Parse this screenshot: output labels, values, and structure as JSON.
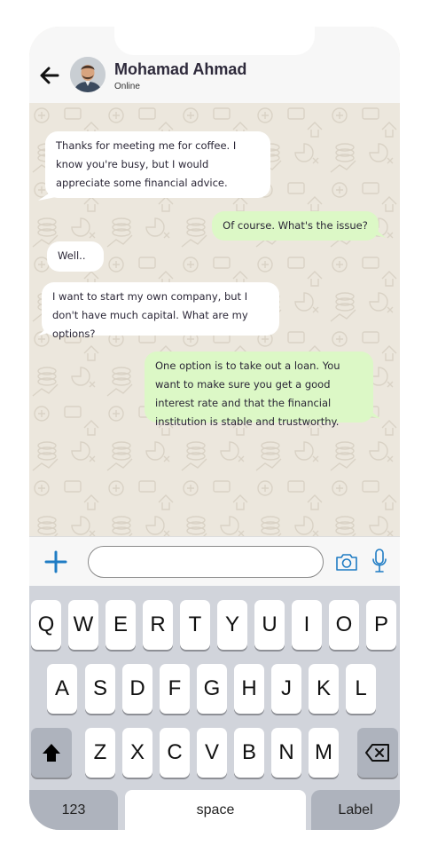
{
  "contact": {
    "name": "Mohamad Ahmad",
    "status": "Online"
  },
  "messages": [
    {
      "side": "in",
      "text": "Thanks for meeting me for coffee. I know you're busy, but I would appreciate some financial advice."
    },
    {
      "side": "out",
      "text": "Of course. What's the issue?"
    },
    {
      "side": "in",
      "text": "Well.."
    },
    {
      "side": "in",
      "text": "I want to start my own company, but I don't have much capital. What are my options?"
    },
    {
      "side": "out",
      "text": "One option is to take out a loan. You want to make sure you get a good interest rate and that the financial institution is stable and trustworthy."
    }
  ],
  "input": {
    "value": "",
    "placeholder": ""
  },
  "keyboard": {
    "row1": [
      "Q",
      "W",
      "E",
      "R",
      "T",
      "Y",
      "U",
      "I",
      "O",
      "P"
    ],
    "row2": [
      "A",
      "S",
      "D",
      "F",
      "G",
      "H",
      "J",
      "K",
      "L"
    ],
    "row3": [
      "Z",
      "X",
      "C",
      "V",
      "B",
      "N",
      "M"
    ],
    "numbers_label": "123",
    "space_label": "space",
    "return_label": "Label"
  },
  "icons": {
    "back": "arrow-left-icon",
    "add": "plus-icon",
    "camera": "camera-icon",
    "mic": "microphone-icon",
    "shift": "shift-arrow-icon",
    "backspace": "backspace-icon"
  },
  "colors": {
    "incoming_bubble": "#ffffff",
    "outgoing_bubble": "#dcf8c6",
    "chat_background": "#ece7dd",
    "accent_blue": "#1f7cc4",
    "name_text": "#2e2a3b"
  }
}
